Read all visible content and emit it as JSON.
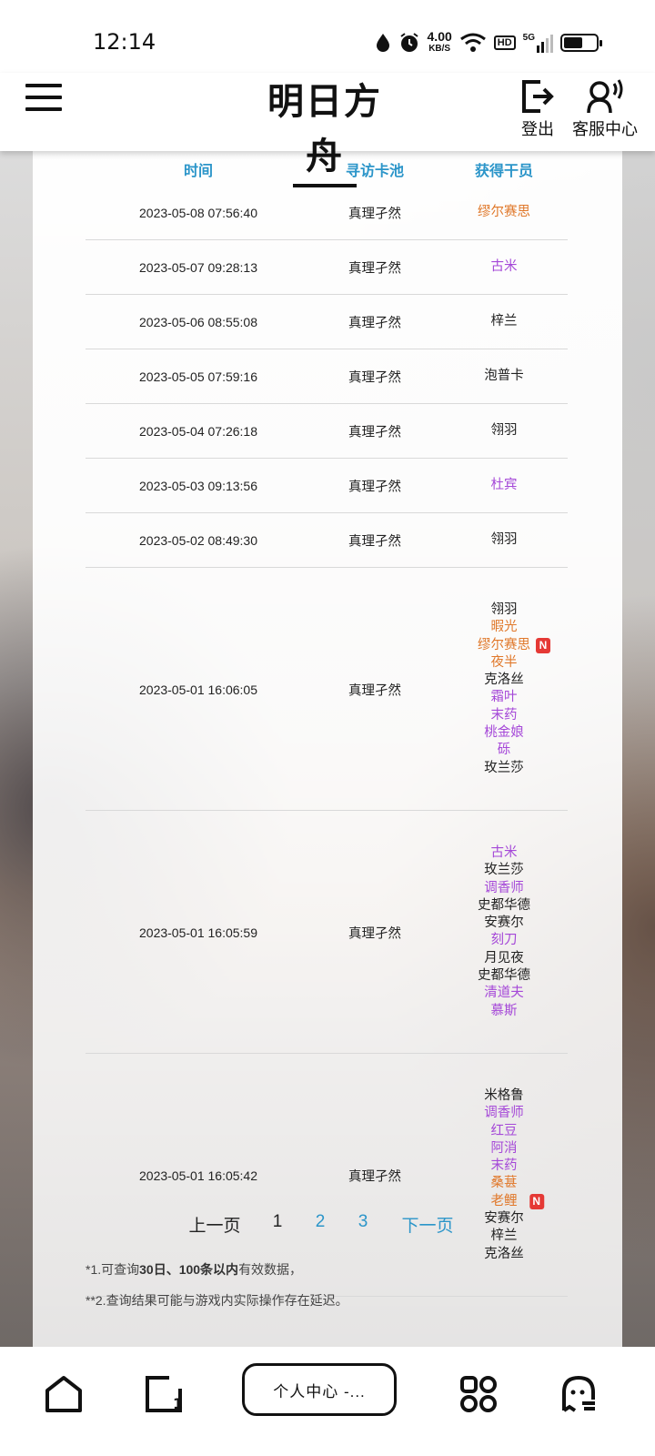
{
  "status_bar": {
    "time": "12:14",
    "net_speed": "4.00",
    "net_unit": "KB/S",
    "hd": "HD",
    "signal": "5G",
    "battery_level": 0.6
  },
  "header": {
    "logo_text": "明日方舟",
    "logout_label": "登出",
    "service_label": "客服中心"
  },
  "colors": {
    "header_text": "#2b95c9",
    "purple": "#a548d8",
    "orange": "#e0782a",
    "normal": "#222222",
    "link": "#2b95c9",
    "new_badge": "#e53935"
  },
  "table": {
    "headers": [
      "时间",
      "寻访卡池",
      "获得干员"
    ],
    "rows": [
      {
        "time": "2023-05-08 07:56:40",
        "pool": "真理孑然",
        "ops": [
          {
            "name": "缪尔赛思",
            "rarity": "orange"
          }
        ]
      },
      {
        "time": "2023-05-07 09:28:13",
        "pool": "真理孑然",
        "ops": [
          {
            "name": "古米",
            "rarity": "purple"
          }
        ]
      },
      {
        "time": "2023-05-06 08:55:08",
        "pool": "真理孑然",
        "ops": [
          {
            "name": "梓兰",
            "rarity": "normal"
          }
        ]
      },
      {
        "time": "2023-05-05 07:59:16",
        "pool": "真理孑然",
        "ops": [
          {
            "name": "泡普卡",
            "rarity": "normal"
          }
        ]
      },
      {
        "time": "2023-05-04 07:26:18",
        "pool": "真理孑然",
        "ops": [
          {
            "name": "翎羽",
            "rarity": "normal"
          }
        ]
      },
      {
        "time": "2023-05-03 09:13:56",
        "pool": "真理孑然",
        "ops": [
          {
            "name": "杜宾",
            "rarity": "purple"
          }
        ]
      },
      {
        "time": "2023-05-02 08:49:30",
        "pool": "真理孑然",
        "ops": [
          {
            "name": "翎羽",
            "rarity": "normal"
          }
        ]
      },
      {
        "time": "2023-05-01 16:06:05",
        "pool": "真理孑然",
        "ops": [
          {
            "name": "翎羽",
            "rarity": "normal"
          },
          {
            "name": "暇光",
            "rarity": "orange"
          },
          {
            "name": "缪尔赛思",
            "rarity": "orange",
            "new": "N"
          },
          {
            "name": "夜半",
            "rarity": "orange"
          },
          {
            "name": "克洛丝",
            "rarity": "normal"
          },
          {
            "name": "霜叶",
            "rarity": "purple"
          },
          {
            "name": "末药",
            "rarity": "purple"
          },
          {
            "name": "桃金娘",
            "rarity": "purple"
          },
          {
            "name": "砾",
            "rarity": "purple"
          },
          {
            "name": "玫兰莎",
            "rarity": "normal"
          }
        ]
      },
      {
        "time": "2023-05-01 16:05:59",
        "pool": "真理孑然",
        "ops": [
          {
            "name": "古米",
            "rarity": "purple"
          },
          {
            "name": "玫兰莎",
            "rarity": "normal"
          },
          {
            "name": "调香师",
            "rarity": "purple"
          },
          {
            "name": "史都华德",
            "rarity": "normal"
          },
          {
            "name": "安赛尔",
            "rarity": "normal"
          },
          {
            "name": "刻刀",
            "rarity": "purple"
          },
          {
            "name": "月见夜",
            "rarity": "normal"
          },
          {
            "name": "史都华德",
            "rarity": "normal"
          },
          {
            "name": "清道夫",
            "rarity": "purple"
          },
          {
            "name": "慕斯",
            "rarity": "purple"
          }
        ]
      },
      {
        "time": "2023-05-01 16:05:42",
        "pool": "真理孑然",
        "ops": [
          {
            "name": "米格鲁",
            "rarity": "normal"
          },
          {
            "name": "调香师",
            "rarity": "purple"
          },
          {
            "name": "红豆",
            "rarity": "purple"
          },
          {
            "name": "阿消",
            "rarity": "purple"
          },
          {
            "name": "末药",
            "rarity": "purple"
          },
          {
            "name": "桑葚",
            "rarity": "orange"
          },
          {
            "name": "老鲤",
            "rarity": "orange",
            "new": "N"
          },
          {
            "name": "安赛尔",
            "rarity": "normal"
          },
          {
            "name": "梓兰",
            "rarity": "normal"
          },
          {
            "name": "克洛丝",
            "rarity": "normal"
          }
        ]
      }
    ]
  },
  "pager": {
    "prev": "上一页",
    "pages": [
      "1",
      "2",
      "3"
    ],
    "current": "1",
    "next": "下一页"
  },
  "notes": {
    "note1_prefix": "*1.可查询",
    "note1_bold": "30日、100条以内",
    "note1_suffix": "有效数据，",
    "note2": "**2.查询结果可能与游戏内实际操作存在延迟。"
  },
  "bottom_nav": {
    "home_icon": "home-icon",
    "tabs_icon": "tab-switcher-icon",
    "tabs_count": "1",
    "current_tab_label": "个人中心 -...",
    "apps_icon": "apps-grid-icon",
    "ghost_icon": "ghost-mode-icon"
  }
}
